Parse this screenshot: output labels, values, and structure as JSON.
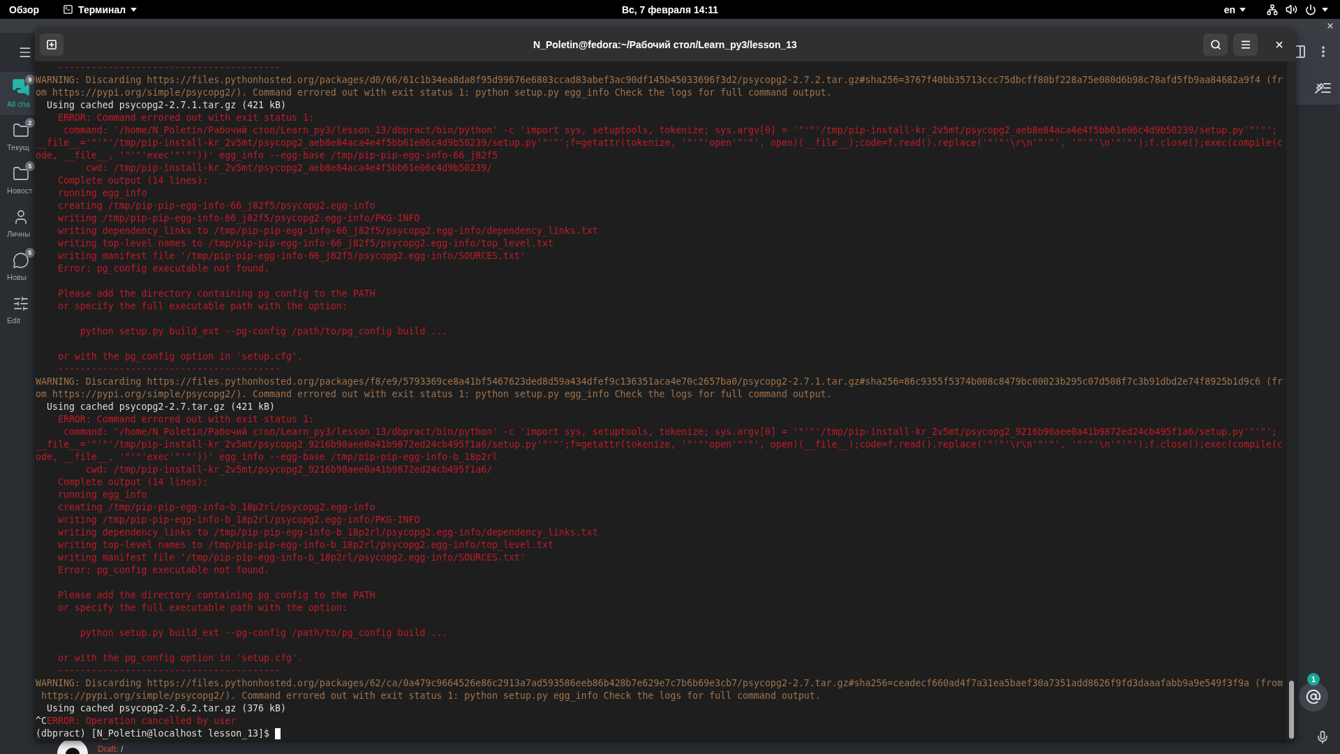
{
  "top_bar": {
    "activities": "Обзор",
    "app_menu": "Терминал",
    "clock": "Вс, 7 февраля 14:11",
    "keyboard_layout": "en"
  },
  "background_app": {
    "sidebar": {
      "items": [
        {
          "kind": "chats",
          "label": "All cha",
          "badge": "9",
          "selected": true
        },
        {
          "kind": "folder",
          "label": "Текущ",
          "badge": "2",
          "selected": false
        },
        {
          "kind": "folder",
          "label": "Новост",
          "badge": "5",
          "selected": false
        },
        {
          "kind": "person",
          "label": "Личны",
          "selected": false
        },
        {
          "kind": "chat",
          "label": "Новы",
          "badge": "5",
          "selected": false
        },
        {
          "kind": "edit",
          "label": "Edit",
          "selected": false
        }
      ]
    },
    "mentions_badge": "1",
    "composer": {
      "draft_label": "Draft:",
      "draft_text": "/"
    }
  },
  "terminal": {
    "title": "N_Poletin@fedora:~/Рабочий стол/Learn_py3/lesson_13",
    "lines": [
      {
        "kind": "error",
        "text": "    ----------------------------------------"
      },
      {
        "kind": "warning",
        "text": "WARNING: Discarding https://files.pythonhosted.org/packages/d0/66/61c1b34ea8da8f95d99676e6803ccad83abef3ac90df145b45033696f3d2/psycopg2-2.7.2.tar.gz#sha256=3767f40bb35713ccc75dbcff80bf228a75e080d6b98c78afd5fb9aa84682a9f4 (fr"
      },
      {
        "kind": "warning",
        "text": "om https://pypi.org/simple/psycopg2/). Command errored out with exit status 1: python setup.py egg_info Check the logs for full command output."
      },
      {
        "kind": "output",
        "text": "  Using cached psycopg2-2.7.1.tar.gz (421 kB)"
      },
      {
        "kind": "error",
        "text": "    ERROR: Command errored out with exit status 1:"
      },
      {
        "kind": "error",
        "text": "     command: '/home/N_Poletin/Рабочий стол/Learn_py3/lesson_13/dbpract/bin/python' -c 'import sys, setuptools, tokenize; sys.argv[0] = '\"'\"'/tmp/pip-install-kr_2v5mt/psycopg2_aeb8e84aca4e4f5bb61e06c4d9b50239/setup.py'\"'\"';"
      },
      {
        "kind": "error",
        "text": "__file__='\"'\"'/tmp/pip-install-kr_2v5mt/psycopg2_aeb8e84aca4e4f5bb61e06c4d9b50239/setup.py'\"'\"';f=getattr(tokenize, '\"'\"'open'\"'\"', open)(__file__);code=f.read().replace('\"'\"'\\r\\n'\"'\"', '\"'\"'\\n'\"'\"');f.close();exec(compile(c"
      },
      {
        "kind": "error",
        "text": "ode, __file__, '\"'\"'exec'\"'\"'))' egg_info --egg-base /tmp/pip-pip-egg-info-66_j82f5"
      },
      {
        "kind": "error",
        "text": "         cwd: /tmp/pip-install-kr_2v5mt/psycopg2_aeb8e84aca4e4f5bb61e06c4d9b50239/"
      },
      {
        "kind": "error",
        "text": "    Complete output (14 lines):"
      },
      {
        "kind": "error",
        "text": "    running egg_info"
      },
      {
        "kind": "error",
        "text": "    creating /tmp/pip-pip-egg-info-66_j82f5/psycopg2.egg-info"
      },
      {
        "kind": "error",
        "text": "    writing /tmp/pip-pip-egg-info-66_j82f5/psycopg2.egg-info/PKG-INFO"
      },
      {
        "kind": "error",
        "text": "    writing dependency_links to /tmp/pip-pip-egg-info-66_j82f5/psycopg2.egg-info/dependency_links.txt"
      },
      {
        "kind": "error",
        "text": "    writing top-level names to /tmp/pip-pip-egg-info-66_j82f5/psycopg2.egg-info/top_level.txt"
      },
      {
        "kind": "error",
        "text": "    writing manifest file '/tmp/pip-pip-egg-info-66_j82f5/psycopg2.egg-info/SOURCES.txt'"
      },
      {
        "kind": "error",
        "text": "    Error: pg_config executable not found."
      },
      {
        "kind": "blank"
      },
      {
        "kind": "error",
        "text": "    Please add the directory containing pg_config to the PATH"
      },
      {
        "kind": "error",
        "text": "    or specify the full executable path with the option:"
      },
      {
        "kind": "blank"
      },
      {
        "kind": "error",
        "text": "        python setup.py build_ext --pg-config /path/to/pg_config build ..."
      },
      {
        "kind": "blank"
      },
      {
        "kind": "error",
        "text": "    or with the pg_config option in 'setup.cfg'."
      },
      {
        "kind": "error",
        "text": "    ----------------------------------------"
      },
      {
        "kind": "warning",
        "text": "WARNING: Discarding https://files.pythonhosted.org/packages/f8/e9/5793369ce8a41bf5467623ded8d59a434dfef9c136351aca4e70c2657ba0/psycopg2-2.7.1.tar.gz#sha256=86c9355f5374b008c8479bc00023b295c07d508f7c3b91dbd2e74f8925b1d9c6 (fr"
      },
      {
        "kind": "warning",
        "text": "om https://pypi.org/simple/psycopg2/). Command errored out with exit status 1: python setup.py egg_info Check the logs for full command output."
      },
      {
        "kind": "output",
        "text": "  Using cached psycopg2-2.7.tar.gz (421 kB)"
      },
      {
        "kind": "error",
        "text": "    ERROR: Command errored out with exit status 1:"
      },
      {
        "kind": "error",
        "text": "     command: '/home/N_Poletin/Рабочий стол/Learn_py3/lesson_13/dbpract/bin/python' -c 'import sys, setuptools, tokenize; sys.argv[0] = '\"'\"'/tmp/pip-install-kr_2v5mt/psycopg2_9216b90aee0a41b9872ed24cb495f1a6/setup.py'\"'\"';"
      },
      {
        "kind": "error",
        "text": "__file__='\"'\"'/tmp/pip-install-kr_2v5mt/psycopg2_9216b90aee0a41b9872ed24cb495f1a6/setup.py'\"'\"';f=getattr(tokenize, '\"'\"'open'\"'\"', open)(__file__);code=f.read().replace('\"'\"'\\r\\n'\"'\"', '\"'\"'\\n'\"'\"');f.close();exec(compile(c"
      },
      {
        "kind": "error",
        "text": "ode, __file__, '\"'\"'exec'\"'\"'))' egg_info --egg-base /tmp/pip-pip-egg-info-b_18p2rl"
      },
      {
        "kind": "error",
        "text": "         cwd: /tmp/pip-install-kr_2v5mt/psycopg2_9216b90aee0a41b9872ed24cb495f1a6/"
      },
      {
        "kind": "error",
        "text": "    Complete output (14 lines):"
      },
      {
        "kind": "error",
        "text": "    running egg_info"
      },
      {
        "kind": "error",
        "text": "    creating /tmp/pip-pip-egg-info-b_18p2rl/psycopg2.egg-info"
      },
      {
        "kind": "error",
        "text": "    writing /tmp/pip-pip-egg-info-b_18p2rl/psycopg2.egg-info/PKG-INFO"
      },
      {
        "kind": "error",
        "text": "    writing dependency_links to /tmp/pip-pip-egg-info-b_18p2rl/psycopg2.egg-info/dependency_links.txt"
      },
      {
        "kind": "error",
        "text": "    writing top-level names to /tmp/pip-pip-egg-info-b_18p2rl/psycopg2.egg-info/top_level.txt"
      },
      {
        "kind": "error",
        "text": "    writing manifest file '/tmp/pip-pip-egg-info-b_18p2rl/psycopg2.egg-info/SOURCES.txt'"
      },
      {
        "kind": "error",
        "text": "    Error: pg_config executable not found."
      },
      {
        "kind": "blank"
      },
      {
        "kind": "error",
        "text": "    Please add the directory containing pg_config to the PATH"
      },
      {
        "kind": "error",
        "text": "    or specify the full executable path with the option:"
      },
      {
        "kind": "blank"
      },
      {
        "kind": "error",
        "text": "        python setup.py build_ext --pg-config /path/to/pg_config build ..."
      },
      {
        "kind": "blank"
      },
      {
        "kind": "error",
        "text": "    or with the pg_config option in 'setup.cfg'."
      },
      {
        "kind": "error",
        "text": "    ----------------------------------------"
      },
      {
        "kind": "warning",
        "text": "WARNING: Discarding https://files.pythonhosted.org/packages/62/ca/0a479c9664526e86c2913a7ad593586eeb86b428b7e629e7c7b6b69e3cb7/psycopg2-2.7.tar.gz#sha256=ceadecf660ad4f7a31ea5baef30a7351add8626f9fd3daaafabb9a9e549f3f9a (from"
      },
      {
        "kind": "warning",
        "text": " https://pypi.org/simple/psycopg2/). Command errored out with exit status 1: python setup.py egg_info Check the logs for full command output."
      },
      {
        "kind": "output",
        "text": "  Using cached psycopg2-2.6.2.tar.gz (376 kB)"
      },
      {
        "kind": "interrupt",
        "prefix": "^C",
        "text": "ERROR: Operation cancelled by user"
      },
      {
        "kind": "prompt",
        "text": "(dbpract) [N_Poletin@localhost lesson_13]$"
      }
    ]
  }
}
